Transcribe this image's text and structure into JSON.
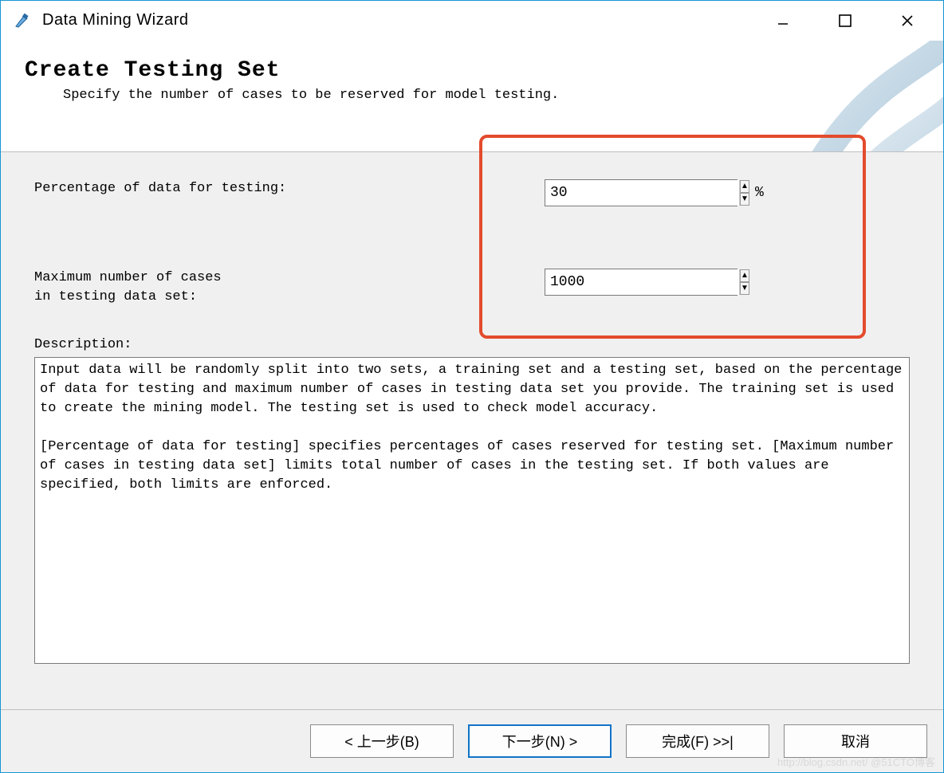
{
  "window": {
    "title": "Data Mining Wizard"
  },
  "header": {
    "title": "Create Testing Set",
    "subtitle": "Specify the number of cases to be reserved for model testing."
  },
  "form": {
    "percentage": {
      "label": "Percentage of data for testing:",
      "value": "30",
      "unit": "%"
    },
    "maxcases": {
      "label": "Maximum number of cases\nin testing data set:",
      "value": "1000"
    }
  },
  "description": {
    "label": "Description:",
    "text_p1": "Input data will be randomly split into two sets, a training set and a testing set, based on the percentage of data for testing and maximum number of cases in testing data set you provide. The training set is used to create the mining model. The testing set is used to check model accuracy.",
    "text_p2": "[Percentage of data for testing] specifies percentages of cases reserved for testing set. [Maximum number of cases in testing data set] limits total number of cases in the testing set. If both values are specified, both limits are enforced."
  },
  "buttons": {
    "back": "< 上一步(B)",
    "next": "下一步(N) >",
    "finish": "完成(F) >>|",
    "cancel": "取消"
  },
  "watermark": "http://blog.csdn.net/ @51CTO博客"
}
